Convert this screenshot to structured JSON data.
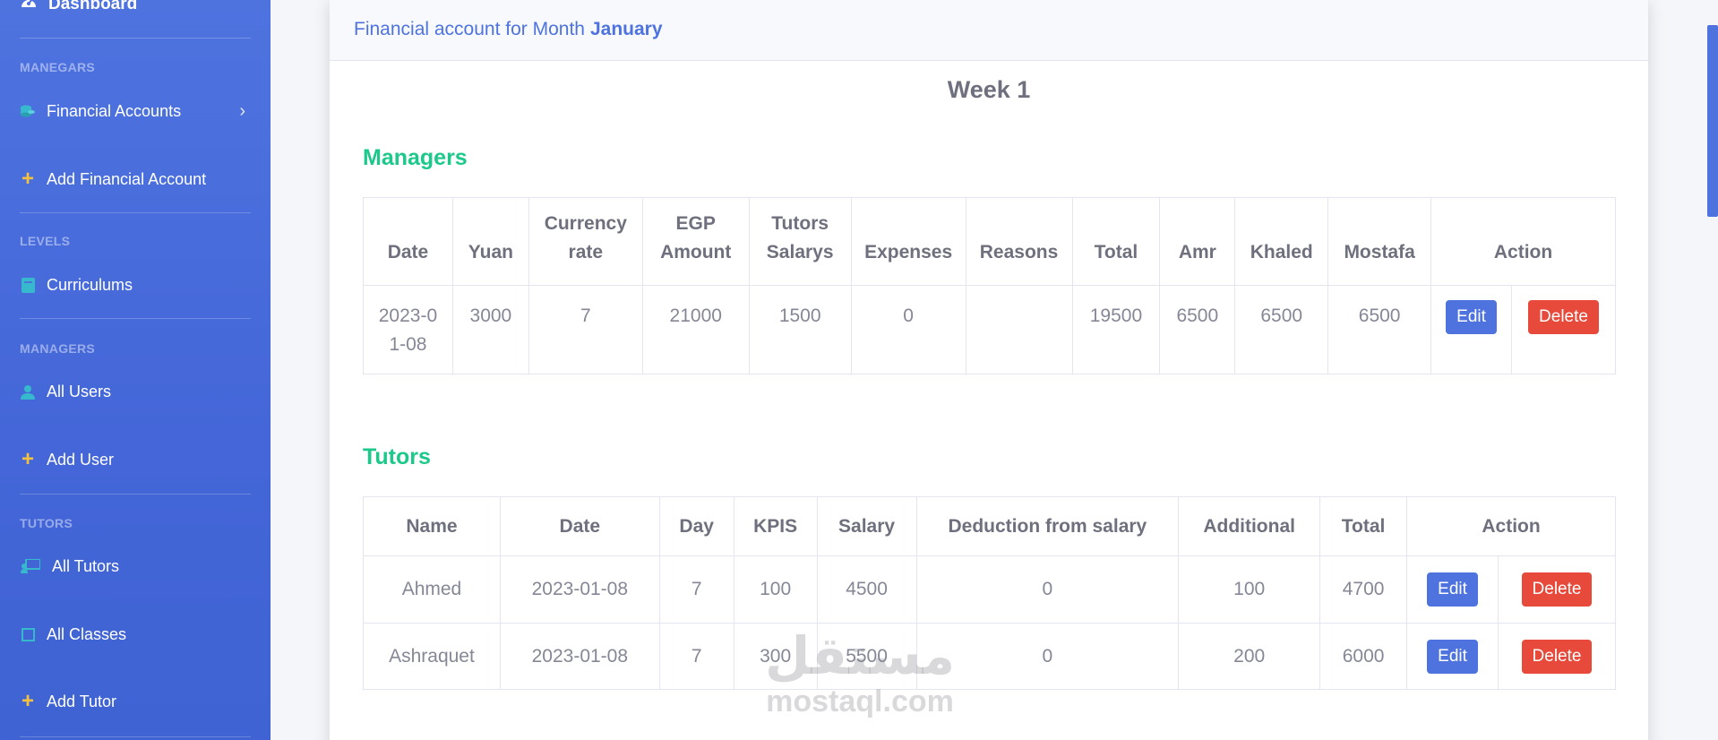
{
  "sidebar": {
    "brand": "Dashboard",
    "sections": [
      {
        "heading": "MANEGARS"
      },
      {
        "heading": "LEVELS"
      },
      {
        "heading": "MANAGERS"
      },
      {
        "heading": "TUTORS"
      }
    ],
    "items": {
      "financial_accounts": "Financial Accounts",
      "add_financial_account": "Add Financial Account",
      "curriculums": "Curriculums",
      "all_users": "All Users",
      "add_user": "Add User",
      "all_tutors": "All Tutors",
      "all_classes": "All Classes",
      "add_tutor": "Add Tutor"
    }
  },
  "card": {
    "header_prefix": "Financial account for Month",
    "month": "January",
    "week_title": "Week 1"
  },
  "managers": {
    "title": "Managers",
    "columns": [
      "Date",
      "Yuan",
      "Currency rate",
      "EGP Amount",
      "Tutors Salarys",
      "Expenses",
      "Reasons",
      "Total",
      "Amr",
      "Khaled",
      "Mostafa",
      "Action"
    ],
    "rows": [
      {
        "date": "2023-01-08",
        "yuan": "3000",
        "rate": "7",
        "egp": "21000",
        "tutors_salarys": "1500",
        "expenses": "0",
        "reasons": "",
        "total": "19500",
        "amr": "6500",
        "khaled": "6500",
        "mostafa": "6500",
        "edit": "Edit",
        "delete": "Delete"
      }
    ]
  },
  "tutors": {
    "title": "Tutors",
    "columns": [
      "Name",
      "Date",
      "Day",
      "KPIS",
      "Salary",
      "Deduction from salary",
      "Additional",
      "Total",
      "Action"
    ],
    "rows": [
      {
        "name": "Ahmed",
        "date": "2023-01-08",
        "day": "7",
        "kpis": "100",
        "salary": "4500",
        "deduction": "0",
        "additional": "100",
        "total": "4700",
        "edit": "Edit",
        "delete": "Delete"
      },
      {
        "name": "Ashraquet",
        "date": "2023-01-08",
        "day": "7",
        "kpis": "300",
        "salary": "5500",
        "deduction": "0",
        "additional": "200",
        "total": "6000",
        "edit": "Edit",
        "delete": "Delete"
      }
    ]
  },
  "watermark": {
    "arabic": "مستقل",
    "latin": "mostaql.com"
  },
  "colors": {
    "primary": "#4e73df",
    "success": "#1cc88a",
    "danger": "#e74a3b",
    "info": "#36b9cc",
    "warning": "#f6c23e"
  }
}
